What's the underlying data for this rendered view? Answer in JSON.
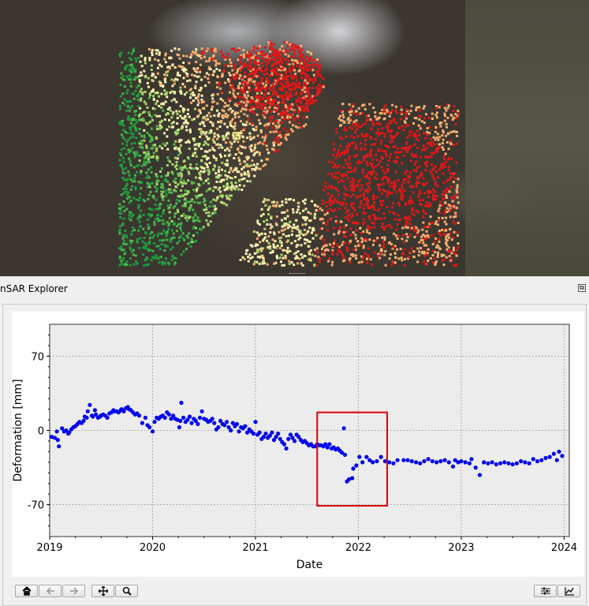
{
  "panel": {
    "title": "nSAR Explorer"
  },
  "chart_data": {
    "type": "scatter",
    "xlabel": "Date",
    "ylabel": "Deformation [mm]",
    "xlim": [
      2019.0,
      2024.05
    ],
    "ylim": [
      -100,
      100
    ],
    "x_ticks": [
      "2019",
      "2020",
      "2021",
      "2022",
      "2023",
      "2024"
    ],
    "y_ticks": [
      "70",
      "0",
      "-70"
    ],
    "grid": true,
    "series_color": "#0000ee",
    "highlight_box": {
      "x_range": [
        2021.6,
        2022.28
      ],
      "y_range": [
        -71,
        17
      ],
      "color": "#dd0000"
    },
    "points": [
      [
        2019.02,
        -6
      ],
      [
        2019.05,
        -7
      ],
      [
        2019.07,
        -1
      ],
      [
        2019.08,
        -9
      ],
      [
        2019.09,
        -15
      ],
      [
        2019.12,
        2
      ],
      [
        2019.14,
        -1
      ],
      [
        2019.16,
        0
      ],
      [
        2019.18,
        -3
      ],
      [
        2019.19,
        -2
      ],
      [
        2019.21,
        1
      ],
      [
        2019.23,
        3
      ],
      [
        2019.25,
        4
      ],
      [
        2019.27,
        6
      ],
      [
        2019.29,
        8
      ],
      [
        2019.31,
        7
      ],
      [
        2019.33,
        9
      ],
      [
        2019.34,
        13
      ],
      [
        2019.36,
        12
      ],
      [
        2019.37,
        18
      ],
      [
        2019.39,
        24
      ],
      [
        2019.41,
        14
      ],
      [
        2019.42,
        13
      ],
      [
        2019.44,
        19
      ],
      [
        2019.45,
        15
      ],
      [
        2019.47,
        12
      ],
      [
        2019.49,
        13
      ],
      [
        2019.5,
        14
      ],
      [
        2019.52,
        15
      ],
      [
        2019.54,
        14
      ],
      [
        2019.56,
        12
      ],
      [
        2019.58,
        16
      ],
      [
        2019.6,
        17
      ],
      [
        2019.62,
        19
      ],
      [
        2019.63,
        18
      ],
      [
        2019.65,
        18
      ],
      [
        2019.67,
        17
      ],
      [
        2019.69,
        19
      ],
      [
        2019.7,
        20
      ],
      [
        2019.72,
        18
      ],
      [
        2019.74,
        21
      ],
      [
        2019.76,
        22
      ],
      [
        2019.77,
        20
      ],
      [
        2019.79,
        19
      ],
      [
        2019.81,
        17
      ],
      [
        2019.83,
        15
      ],
      [
        2019.85,
        16
      ],
      [
        2019.87,
        14
      ],
      [
        2019.9,
        7
      ],
      [
        2019.93,
        12
      ],
      [
        2019.95,
        5
      ],
      [
        2019.97,
        3
      ],
      [
        2020.0,
        -1
      ],
      [
        2020.02,
        8
      ],
      [
        2020.04,
        12
      ],
      [
        2020.06,
        11
      ],
      [
        2020.08,
        13
      ],
      [
        2020.1,
        14
      ],
      [
        2020.12,
        12
      ],
      [
        2020.14,
        17
      ],
      [
        2020.16,
        15
      ],
      [
        2020.18,
        11
      ],
      [
        2020.2,
        14
      ],
      [
        2020.22,
        11
      ],
      [
        2020.24,
        10
      ],
      [
        2020.26,
        3
      ],
      [
        2020.27,
        9
      ],
      [
        2020.28,
        26
      ],
      [
        2020.3,
        12
      ],
      [
        2020.32,
        8
      ],
      [
        2020.34,
        10
      ],
      [
        2020.36,
        13
      ],
      [
        2020.38,
        7
      ],
      [
        2020.4,
        11
      ],
      [
        2020.42,
        9
      ],
      [
        2020.44,
        6
      ],
      [
        2020.46,
        12
      ],
      [
        2020.48,
        18
      ],
      [
        2020.5,
        11
      ],
      [
        2020.52,
        10
      ],
      [
        2020.54,
        8
      ],
      [
        2020.56,
        9
      ],
      [
        2020.58,
        11
      ],
      [
        2020.6,
        7
      ],
      [
        2020.62,
        1
      ],
      [
        2020.64,
        3
      ],
      [
        2020.66,
        9
      ],
      [
        2020.68,
        6
      ],
      [
        2020.7,
        5
      ],
      [
        2020.72,
        8
      ],
      [
        2020.74,
        3
      ],
      [
        2020.76,
        0
      ],
      [
        2020.78,
        7
      ],
      [
        2020.8,
        4
      ],
      [
        2020.82,
        6
      ],
      [
        2020.84,
        -1
      ],
      [
        2020.86,
        3
      ],
      [
        2020.88,
        2
      ],
      [
        2020.9,
        4
      ],
      [
        2020.92,
        -2
      ],
      [
        2020.94,
        1
      ],
      [
        2020.96,
        -1
      ],
      [
        2020.98,
        -3
      ],
      [
        2021.0,
        8
      ],
      [
        2021.02,
        -4
      ],
      [
        2021.04,
        -2
      ],
      [
        2021.06,
        -8
      ],
      [
        2021.08,
        -6
      ],
      [
        2021.1,
        -3
      ],
      [
        2021.12,
        -7
      ],
      [
        2021.14,
        -5
      ],
      [
        2021.16,
        -2
      ],
      [
        2021.18,
        -9
      ],
      [
        2021.2,
        -6
      ],
      [
        2021.22,
        -3
      ],
      [
        2021.24,
        -8
      ],
      [
        2021.26,
        -11
      ],
      [
        2021.28,
        -13
      ],
      [
        2021.3,
        -17
      ],
      [
        2021.32,
        -8
      ],
      [
        2021.34,
        -4
      ],
      [
        2021.36,
        -7
      ],
      [
        2021.38,
        -10
      ],
      [
        2021.4,
        -4
      ],
      [
        2021.42,
        -6
      ],
      [
        2021.44,
        -9
      ],
      [
        2021.46,
        -11
      ],
      [
        2021.48,
        -10
      ],
      [
        2021.5,
        -12
      ],
      [
        2021.52,
        -14
      ],
      [
        2021.54,
        -13
      ],
      [
        2021.56,
        -15
      ],
      [
        2021.58,
        -15
      ],
      [
        2021.6,
        -13
      ],
      [
        2021.62,
        -14
      ],
      [
        2021.64,
        -14
      ],
      [
        2021.66,
        -15
      ],
      [
        2021.68,
        -13
      ],
      [
        2021.7,
        -16
      ],
      [
        2021.72,
        -13
      ],
      [
        2021.74,
        -17
      ],
      [
        2021.76,
        -16
      ],
      [
        2021.78,
        -18
      ],
      [
        2021.8,
        -17
      ],
      [
        2021.82,
        -19
      ],
      [
        2021.84,
        -21
      ],
      [
        2021.86,
        2
      ],
      [
        2021.87,
        -23
      ],
      [
        2021.89,
        -48
      ],
      [
        2021.91,
        -46
      ],
      [
        2021.94,
        -45
      ],
      [
        2021.95,
        -36
      ],
      [
        2021.98,
        -33
      ],
      [
        2022.01,
        -25
      ],
      [
        2022.04,
        -30
      ],
      [
        2022.08,
        -25
      ],
      [
        2022.11,
        -28
      ],
      [
        2022.14,
        -30
      ],
      [
        2022.18,
        -29
      ],
      [
        2022.22,
        -25
      ],
      [
        2022.26,
        -29
      ],
      [
        2022.3,
        -30
      ],
      [
        2022.34,
        -31
      ],
      [
        2022.38,
        -28
      ],
      [
        2022.44,
        -28
      ],
      [
        2022.48,
        -28
      ],
      [
        2022.52,
        -29
      ],
      [
        2022.56,
        -30
      ],
      [
        2022.6,
        -31
      ],
      [
        2022.64,
        -29
      ],
      [
        2022.68,
        -27
      ],
      [
        2022.72,
        -29
      ],
      [
        2022.76,
        -30
      ],
      [
        2022.8,
        -29
      ],
      [
        2022.84,
        -28
      ],
      [
        2022.88,
        -30
      ],
      [
        2022.92,
        -34
      ],
      [
        2022.94,
        -28
      ],
      [
        2022.97,
        -30
      ],
      [
        2023.0,
        -29
      ],
      [
        2023.04,
        -30
      ],
      [
        2023.08,
        -31
      ],
      [
        2023.1,
        -27
      ],
      [
        2023.14,
        -35
      ],
      [
        2023.18,
        -42
      ],
      [
        2023.22,
        -30
      ],
      [
        2023.26,
        -31
      ],
      [
        2023.3,
        -30
      ],
      [
        2023.34,
        -32
      ],
      [
        2023.38,
        -31
      ],
      [
        2023.42,
        -30
      ],
      [
        2023.46,
        -31
      ],
      [
        2023.5,
        -32
      ],
      [
        2023.54,
        -31
      ],
      [
        2023.58,
        -29
      ],
      [
        2023.62,
        -30
      ],
      [
        2023.66,
        -31
      ],
      [
        2023.7,
        -27
      ],
      [
        2023.74,
        -29
      ],
      [
        2023.78,
        -28
      ],
      [
        2023.82,
        -26
      ],
      [
        2023.86,
        -25
      ],
      [
        2023.9,
        -22
      ],
      [
        2023.93,
        -28
      ],
      [
        2023.95,
        -20
      ],
      [
        2023.98,
        -24
      ]
    ]
  },
  "toolbar": {
    "left_buttons": [
      "home-icon",
      "back-arrow-icon",
      "forward-arrow-icon",
      "pan-icon",
      "zoom-icon"
    ],
    "right_buttons": [
      "subplots-config-icon",
      "axes-edit-icon"
    ]
  }
}
